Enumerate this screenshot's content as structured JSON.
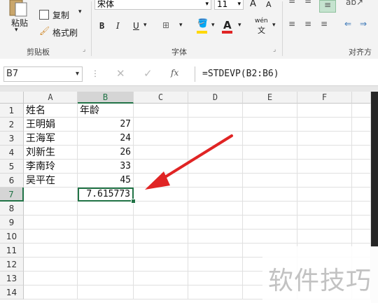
{
  "ribbon": {
    "paste_label": "粘贴",
    "copy_label": "复制",
    "format_painter_label": "格式刷",
    "clipboard_group": "剪贴板",
    "font_name": "宋体",
    "font_size": "11",
    "grow_font": "A",
    "shrink_font": "A",
    "bold": "B",
    "italic": "I",
    "underline": "U",
    "wen_label": "wén",
    "wen_sub": "文",
    "font_group": "字体",
    "align_group": "对齐方"
  },
  "formula_bar": {
    "name_box": "B7",
    "fx": "fx",
    "formula": "=STDEVP(B2:B6)"
  },
  "sheet": {
    "columns": [
      "A",
      "B",
      "C",
      "D",
      "E",
      "F"
    ],
    "rows": [
      {
        "num": "1",
        "a": "姓名",
        "b": "年龄"
      },
      {
        "num": "2",
        "a": "王明娟",
        "b": "27"
      },
      {
        "num": "3",
        "a": "王海军",
        "b": "24"
      },
      {
        "num": "4",
        "a": "刘新生",
        "b": "26"
      },
      {
        "num": "5",
        "a": "李南玲",
        "b": "33"
      },
      {
        "num": "6",
        "a": "吴平在",
        "b": "45"
      },
      {
        "num": "7",
        "a": "",
        "b": "7.615773"
      },
      {
        "num": "8",
        "a": "",
        "b": ""
      },
      {
        "num": "9",
        "a": "",
        "b": ""
      },
      {
        "num": "10",
        "a": "",
        "b": ""
      },
      {
        "num": "11",
        "a": "",
        "b": ""
      },
      {
        "num": "12",
        "a": "",
        "b": ""
      },
      {
        "num": "13",
        "a": "",
        "b": ""
      },
      {
        "num": "14",
        "a": "",
        "b": ""
      }
    ]
  },
  "watermark": "软件技巧",
  "colors": {
    "accent": "#217346",
    "arrow": "#e02424"
  }
}
